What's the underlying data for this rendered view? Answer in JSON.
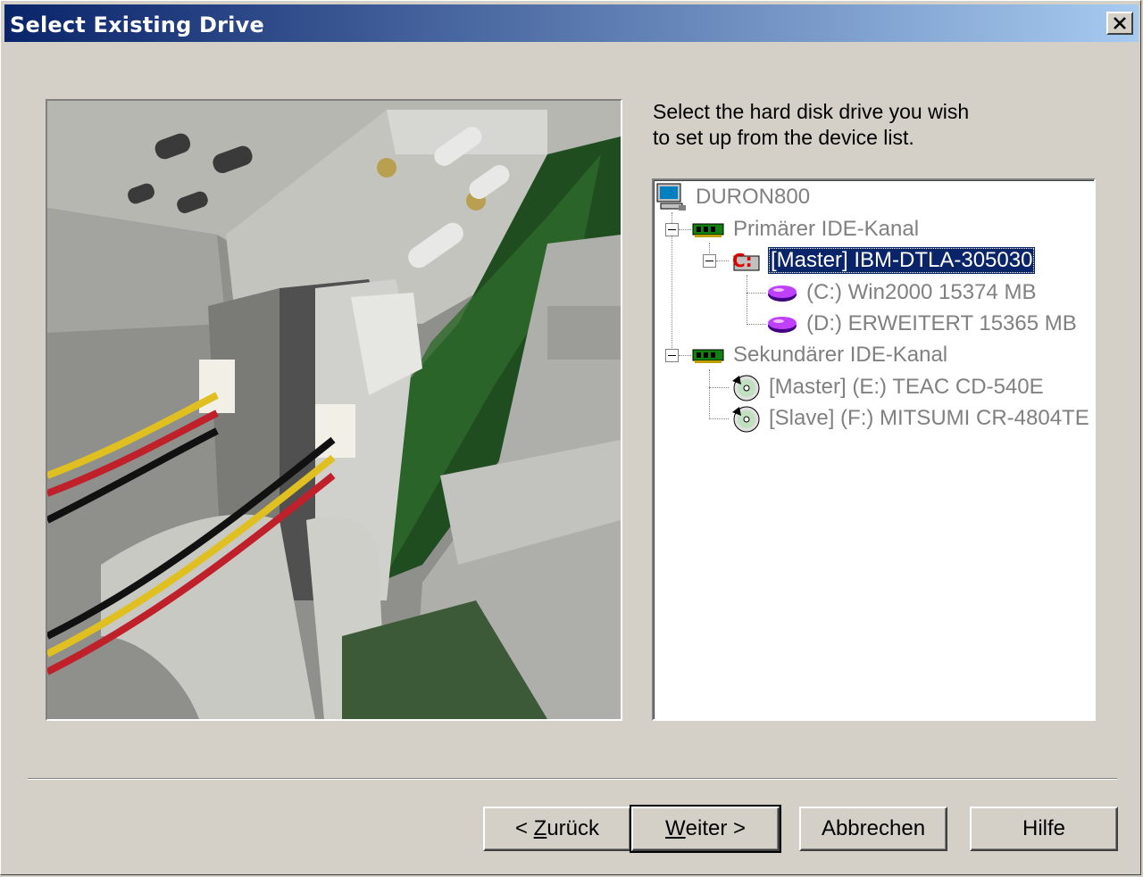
{
  "window": {
    "title": "Select Existing Drive"
  },
  "instructions": {
    "line1": "Select the hard disk drive you wish",
    "line2": "to set up from the device list."
  },
  "device_tree": {
    "root": {
      "label": "DURON800",
      "icon": "computer-icon"
    },
    "channels": [
      {
        "label": "Primärer IDE-Kanal",
        "icon": "ide-controller-icon",
        "devices": [
          {
            "label": "[Master] IBM-DTLA-305030",
            "icon": "hard-disk-icon",
            "selected": true,
            "partitions": [
              {
                "label": "(C:) Win2000 15374 MB",
                "icon": "partition-icon"
              },
              {
                "label": "(D:) ERWEITERT 15365 MB",
                "icon": "partition-icon"
              }
            ]
          }
        ]
      },
      {
        "label": "Sekundärer IDE-Kanal",
        "icon": "ide-controller-icon",
        "devices": [
          {
            "label": "[Master] (E:) TEAC CD-540E",
            "icon": "cd-drive-icon"
          },
          {
            "label": "[Slave] (F:) MITSUMI CR-4804TE",
            "icon": "cd-drive-icon"
          }
        ]
      }
    ]
  },
  "buttons": {
    "back": {
      "prefix": "< ",
      "mnemonic": "Z",
      "rest": "urück"
    },
    "next": {
      "mnemonic": "W",
      "rest": "eiter >"
    },
    "cancel": "Abbrechen",
    "help": "Hilfe"
  },
  "colors": {
    "titlebar_start": "#0a246a",
    "titlebar_end": "#a6caf0",
    "selection": "#0a246a",
    "dialog_bg": "#d4d0c8"
  }
}
